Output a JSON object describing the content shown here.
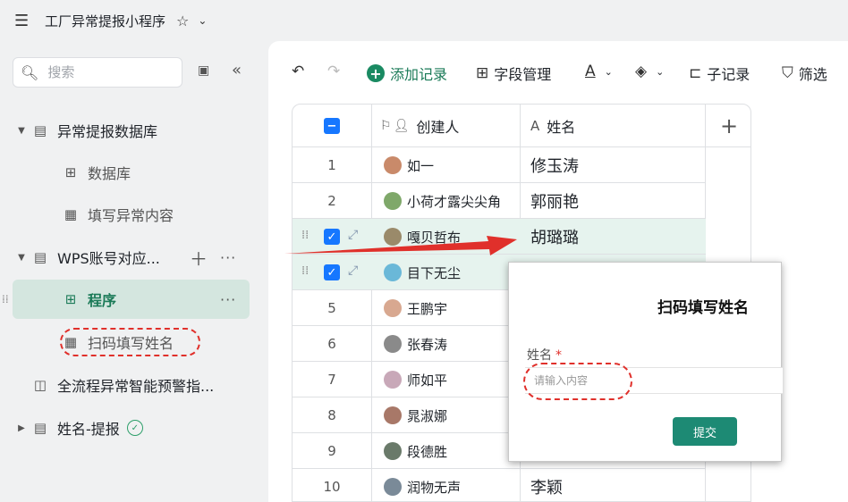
{
  "app": {
    "title": "工厂异常提报小程序"
  },
  "sidebar": {
    "search_placeholder": "搜索",
    "tree": [
      {
        "label": "异常提报数据库"
      },
      {
        "label": "数据库"
      },
      {
        "label": "填写异常内容"
      },
      {
        "label": "WPS账号对应..."
      },
      {
        "label": "程序"
      },
      {
        "label": "扫码填写姓名"
      },
      {
        "label": "全流程异常智能预警指..."
      },
      {
        "label": "姓名-提报"
      }
    ]
  },
  "toolbar": {
    "add_record": "添加记录",
    "field_manage": "字段管理",
    "sub_record": "子记录",
    "filter": "筛选"
  },
  "table": {
    "headers": {
      "creator": "创建人",
      "name": "姓名"
    },
    "rows": [
      {
        "num": "1",
        "creator": "如一",
        "name": "修玉涛"
      },
      {
        "num": "2",
        "creator": "小荷才露尖尖角",
        "name": "郭丽艳"
      },
      {
        "num": "",
        "creator": "嘎贝哲布",
        "name": "胡璐璐"
      },
      {
        "num": "",
        "creator": "目下无尘",
        "name": ""
      },
      {
        "num": "5",
        "creator": "王鹏宇",
        "name": ""
      },
      {
        "num": "6",
        "creator": "张春涛",
        "name": ""
      },
      {
        "num": "7",
        "creator": "师如平",
        "name": ""
      },
      {
        "num": "8",
        "creator": "晁淑娜",
        "name": ""
      },
      {
        "num": "9",
        "creator": "段德胜",
        "name": ""
      },
      {
        "num": "10",
        "creator": "润物无声",
        "name": "李颖"
      }
    ]
  },
  "popup": {
    "title": "扫码填写姓名",
    "field_label": "姓名",
    "required_mark": "*",
    "input_placeholder": "请输入内容",
    "submit": "提交"
  },
  "colors": {
    "accent": "#1a8a62",
    "highlight_row": "#e6f3ee",
    "annotation": "#e0302b"
  }
}
